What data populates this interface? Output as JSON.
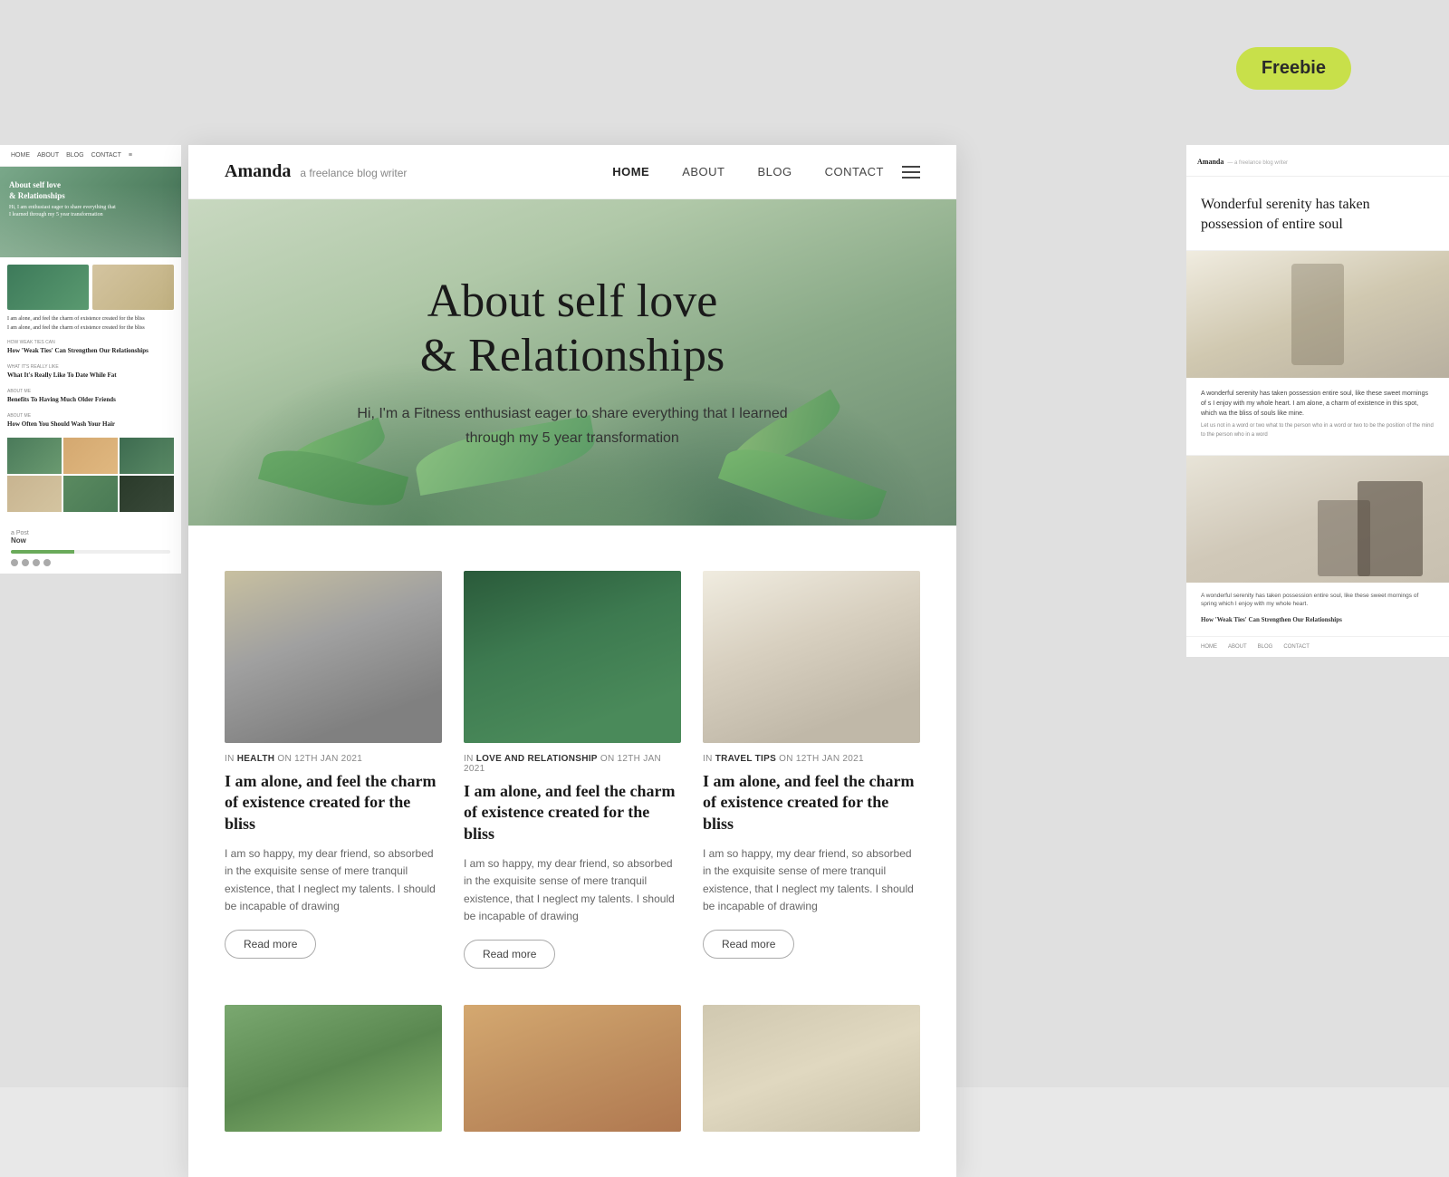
{
  "page": {
    "background_color": "#e0e0e0"
  },
  "freebie": {
    "label": "Freebie"
  },
  "main_navbar": {
    "brand_name": "Amanda",
    "brand_tagline": "a freelance blog writer",
    "nav_items": [
      {
        "id": "home",
        "label": "HOME",
        "active": true
      },
      {
        "id": "about",
        "label": "ABOUT",
        "active": false
      },
      {
        "id": "blog",
        "label": "BLOG",
        "active": false
      },
      {
        "id": "contact",
        "label": "CONTACT",
        "active": false
      }
    ]
  },
  "hero": {
    "title_line1": "About self love",
    "title_line2": "& Relationships",
    "subtitle": "Hi, I'm a Fitness enthusiast eager to share everything that I learned through my 5 year transformation"
  },
  "blog_cards": [
    {
      "id": "card1",
      "category": "HEALTH",
      "date": "12TH JAN 2021",
      "title": "I am alone, and feel the charm of existence created for the bliss",
      "excerpt": "I am so happy, my dear friend, so absorbed in the exquisite sense of mere tranquil existence, that I neglect my talents. I should be incapable of drawing",
      "read_more": "Read more",
      "img_type": "water-bottle"
    },
    {
      "id": "card2",
      "category": "LOVE AND RELATIONSHIP",
      "date": "12TH JAN 2021",
      "title": "I am alone, and feel the charm of existence created for the bliss",
      "excerpt": "I am so happy, my dear friend, so absorbed in the exquisite sense of mere tranquil existence, that I neglect my talents. I should be incapable of drawing",
      "read_more": "Read more",
      "img_type": "succulents"
    },
    {
      "id": "card3",
      "category": "TRAVEL TIPS",
      "date": "12TH JAN 2021",
      "title": "I am alone, and feel the charm of existence created for the bliss",
      "excerpt": "I am so happy, my dear friend, so absorbed in the exquisite sense of mere tranquil existence, that I neglect my talents. I should be incapable of drawing",
      "read_more": "Read more",
      "img_type": "products-beauty"
    }
  ],
  "left_preview": {
    "brand_name": "Amanda",
    "hero_text_line1": "About self love",
    "hero_text_line2": "& Relationships",
    "hero_subtitle": "Hi, I am enthusiast eager to share everything that I learned through my 5 year transformation",
    "blog_list": [
      {
        "category": "HOW WEAK TIES",
        "title": "How 'Weak Ties' Can Strengthen Our Relationships"
      },
      {
        "category": "WHAT IT'S REALLY LIKE",
        "title": "What It's Really Like To Date While Fat"
      },
      {
        "category": "ABOUT ME",
        "title": "Benefits To Having Much Older Friends"
      },
      {
        "category": "ABOUT ME",
        "title": "How Often You Should Wash Your Hair"
      }
    ],
    "live_post_label": "a Post",
    "live_post_sublabel": "Now"
  },
  "right_preview": {
    "brand_name": "Amanda",
    "brand_tagline": "a freelance blog writer",
    "hero_quote": "Wonderful serenity has taken possession of entire soul",
    "body_text": "A wonderful serenity has taken possession entire soul, like these sweet mornings of s I enjoy with my whole heart. I am alone, a charm of existence in this spot, which wa the bliss of souls like mine.",
    "body_small_text": "Let us not in a word or two what to the person who in a word or two to be the position of the mind to the person who in a word",
    "subtitle_bottom": "How 'Weak Ties' Can Strengthen Our Relationships",
    "footer_nav": [
      "HOME",
      "ABOUT",
      "BLOG",
      "CONTACT"
    ]
  }
}
